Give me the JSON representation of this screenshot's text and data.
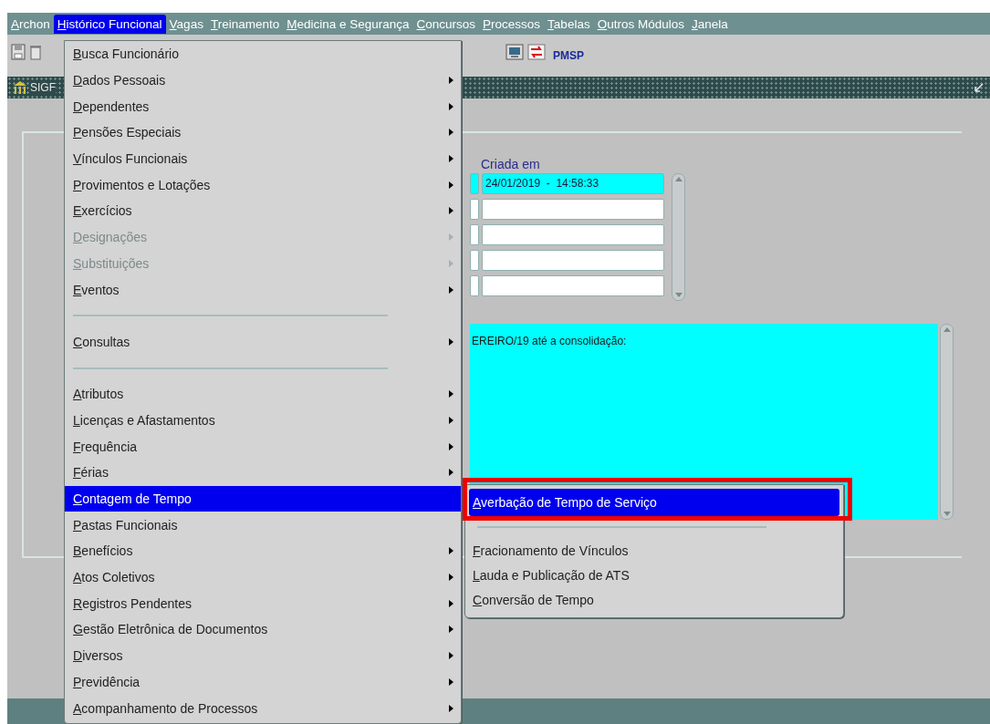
{
  "menu_bar": {
    "items": [
      {
        "label": "Archon",
        "selected": false
      },
      {
        "label": "Histórico Funcional",
        "selected": true
      },
      {
        "label": "Vagas",
        "selected": false
      },
      {
        "label": "Treinamento",
        "selected": false
      },
      {
        "label": "Medicina e Segurança",
        "selected": false
      },
      {
        "label": "Concursos",
        "selected": false
      },
      {
        "label": "Processos",
        "selected": false
      },
      {
        "label": "Tabelas",
        "selected": false
      },
      {
        "label": "Outros Módulos",
        "selected": false
      },
      {
        "label": "Janela",
        "selected": false
      }
    ]
  },
  "toolbar": {
    "label": "PMSP"
  },
  "window": {
    "title": "SIGF"
  },
  "form": {
    "column_label": "Criada em",
    "rows": [
      {
        "value": "24/01/2019  -  14:58:33",
        "selected": true
      },
      {
        "selected": false
      },
      {
        "selected": false
      },
      {
        "selected": false
      },
      {
        "selected": false
      }
    ],
    "text_area": {
      "value": "EREIRO/19 até a consolidação:"
    }
  },
  "menu": {
    "items": [
      {
        "kind": "item",
        "label": "Busca Funcionário",
        "submenu": false,
        "disabled": false,
        "selected": false
      },
      {
        "kind": "item",
        "label": "Dados Pessoais",
        "submenu": true,
        "disabled": false,
        "selected": false
      },
      {
        "kind": "item",
        "label": "Dependentes",
        "submenu": true,
        "disabled": false,
        "selected": false
      },
      {
        "kind": "item",
        "label": "Pensões Especiais",
        "submenu": true,
        "disabled": false,
        "selected": false
      },
      {
        "kind": "item",
        "label": "Vínculos Funcionais",
        "submenu": true,
        "disabled": false,
        "selected": false
      },
      {
        "kind": "item",
        "label": "Provimentos e Lotações",
        "submenu": true,
        "disabled": false,
        "selected": false
      },
      {
        "kind": "item",
        "label": "Exercícios",
        "submenu": true,
        "disabled": false,
        "selected": false
      },
      {
        "kind": "item",
        "label": "Designações",
        "submenu": true,
        "disabled": true,
        "selected": false
      },
      {
        "kind": "item",
        "label": "Substituições",
        "submenu": true,
        "disabled": true,
        "selected": false
      },
      {
        "kind": "item",
        "label": "Eventos",
        "submenu": true,
        "disabled": false,
        "selected": false
      },
      {
        "kind": "separator"
      },
      {
        "kind": "item",
        "label": "Consultas",
        "submenu": true,
        "disabled": false,
        "selected": false
      },
      {
        "kind": "separator"
      },
      {
        "kind": "item",
        "label": "Atributos",
        "submenu": true,
        "disabled": false,
        "selected": false
      },
      {
        "kind": "item",
        "label": "Licenças e Afastamentos",
        "submenu": true,
        "disabled": false,
        "selected": false
      },
      {
        "kind": "item",
        "label": "Frequência",
        "submenu": true,
        "disabled": false,
        "selected": false
      },
      {
        "kind": "item",
        "label": "Férias",
        "submenu": true,
        "disabled": false,
        "selected": false
      },
      {
        "kind": "item",
        "label": "Contagem de Tempo",
        "submenu": false,
        "disabled": false,
        "selected": true
      },
      {
        "kind": "item",
        "label": "Pastas Funcionais",
        "submenu": false,
        "disabled": false,
        "selected": false
      },
      {
        "kind": "item",
        "label": "Benefícios",
        "submenu": true,
        "disabled": false,
        "selected": false
      },
      {
        "kind": "item",
        "label": "Atos Coletivos",
        "submenu": true,
        "disabled": false,
        "selected": false
      },
      {
        "kind": "item",
        "label": "Registros Pendentes",
        "submenu": true,
        "disabled": false,
        "selected": false
      },
      {
        "kind": "item",
        "label": "Gestão Eletrônica de Documentos",
        "submenu": true,
        "disabled": false,
        "selected": false
      },
      {
        "kind": "item",
        "label": "Diversos",
        "submenu": true,
        "disabled": false,
        "selected": false
      },
      {
        "kind": "item",
        "label": "Previdência",
        "submenu": true,
        "disabled": false,
        "selected": false
      },
      {
        "kind": "item",
        "label": "Acompanhamento de Processos",
        "submenu": true,
        "disabled": false,
        "selected": false
      }
    ]
  },
  "submenu": {
    "items": [
      {
        "kind": "item",
        "label": "Averbação de Tempo de Serviço",
        "selected": true
      },
      {
        "kind": "separator"
      },
      {
        "kind": "item",
        "label": "Fracionamento de Vínculos",
        "selected": false
      },
      {
        "kind": "item",
        "label": "Lauda e Publicação de ATS",
        "selected": false
      },
      {
        "kind": "item",
        "label": "Conversão de Tempo",
        "selected": false
      }
    ]
  },
  "annotation": {
    "kind": "frame"
  }
}
